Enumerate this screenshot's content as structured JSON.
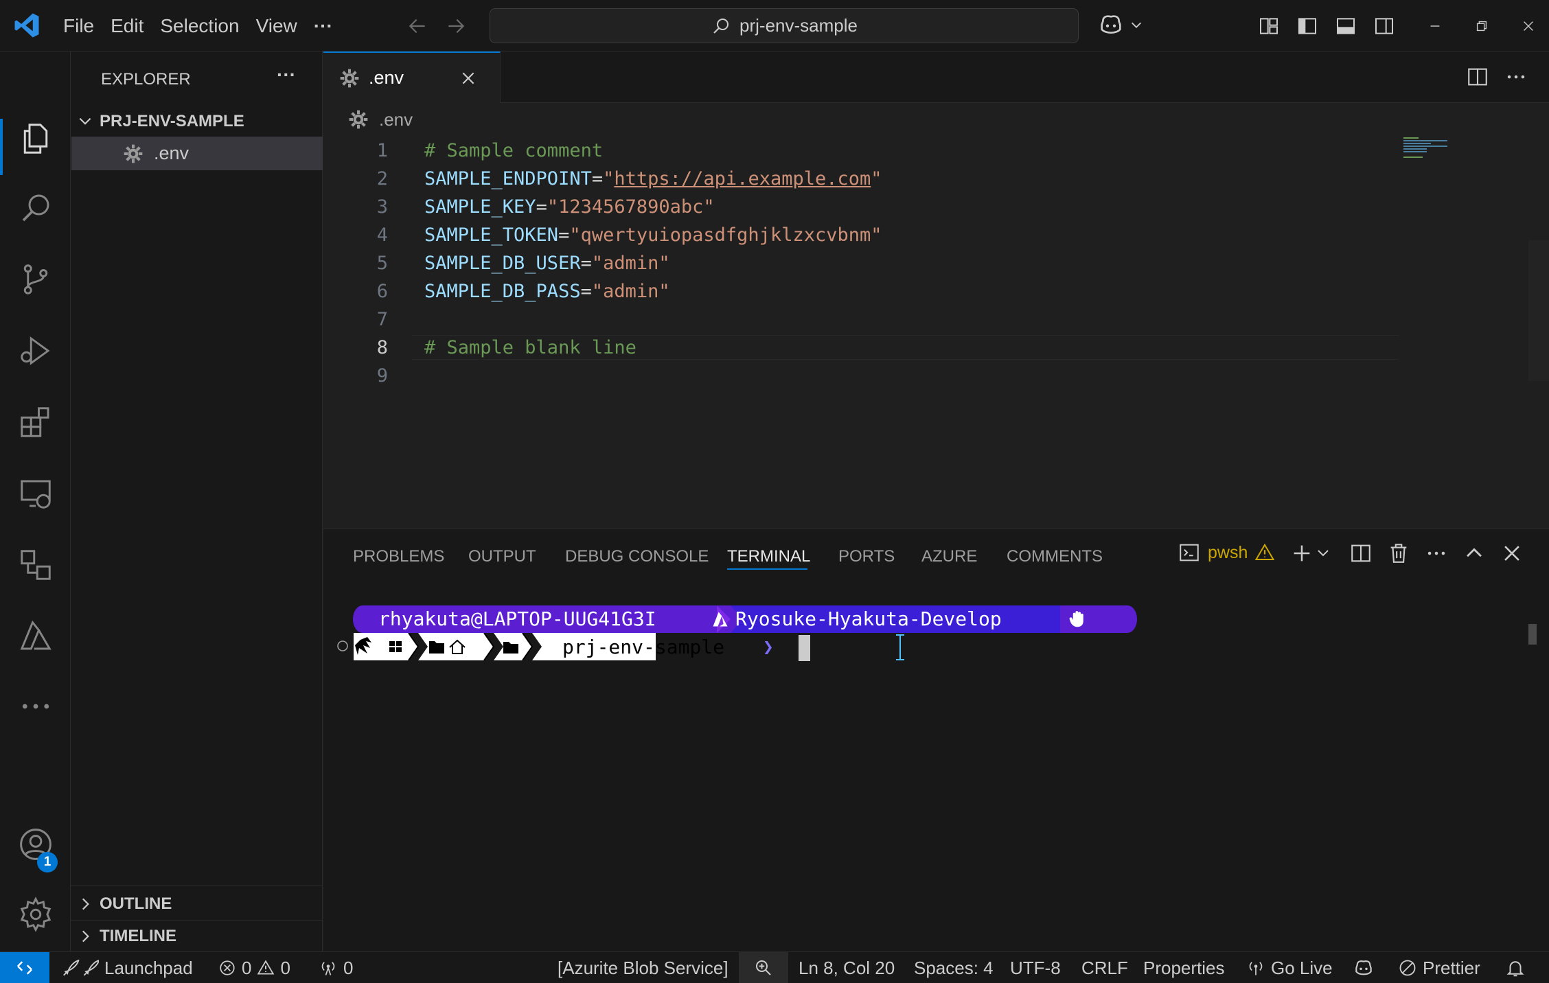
{
  "titlebar": {
    "menu": [
      "File",
      "Edit",
      "Selection",
      "View"
    ],
    "more": "···",
    "search_text": "prj-env-sample"
  },
  "sidebar": {
    "title": "EXPLORER",
    "more": "···",
    "folder": "PRJ-ENV-SAMPLE",
    "file": ".env",
    "outline": "OUTLINE",
    "timeline": "TIMELINE"
  },
  "editor": {
    "tab_label": ".env",
    "breadcrumb": ".env",
    "current_line": 8,
    "lines": [
      {
        "n": "1",
        "parts": [
          {
            "t": "# Sample comment",
            "c": "comment"
          }
        ]
      },
      {
        "n": "2",
        "parts": [
          {
            "t": "SAMPLE_ENDPOINT",
            "c": "key"
          },
          {
            "t": "=",
            "c": "op"
          },
          {
            "t": "\"",
            "c": "str"
          },
          {
            "t": "https://api.example.com",
            "c": "url"
          },
          {
            "t": "\"",
            "c": "str"
          }
        ]
      },
      {
        "n": "3",
        "parts": [
          {
            "t": "SAMPLE_KEY",
            "c": "key"
          },
          {
            "t": "=",
            "c": "op"
          },
          {
            "t": "\"1234567890abc\"",
            "c": "str"
          }
        ]
      },
      {
        "n": "4",
        "parts": [
          {
            "t": "SAMPLE_TOKEN",
            "c": "key"
          },
          {
            "t": "=",
            "c": "op"
          },
          {
            "t": "\"qwertyuiopasdfghjklzxcvbnm\"",
            "c": "str"
          }
        ]
      },
      {
        "n": "5",
        "parts": [
          {
            "t": "SAMPLE_DB_USER",
            "c": "key"
          },
          {
            "t": "=",
            "c": "op"
          },
          {
            "t": "\"admin\"",
            "c": "str"
          }
        ]
      },
      {
        "n": "6",
        "parts": [
          {
            "t": "SAMPLE_DB_PASS",
            "c": "key"
          },
          {
            "t": "=",
            "c": "op"
          },
          {
            "t": "\"admin\"",
            "c": "str"
          }
        ]
      },
      {
        "n": "7",
        "parts": []
      },
      {
        "n": "8",
        "parts": [
          {
            "t": "# Sample blank line",
            "c": "comment"
          }
        ]
      },
      {
        "n": "9",
        "parts": []
      }
    ]
  },
  "panel": {
    "tabs": [
      "PROBLEMS",
      "OUTPUT",
      "DEBUG CONSOLE",
      "TERMINAL",
      "PORTS",
      "AZURE",
      "COMMENTS"
    ],
    "active_tab": "TERMINAL",
    "shell": "pwsh",
    "prompt": {
      "user_host": "rhyakuta@LAPTOP-UUG41G3I",
      "azure_account": "Ryosuke-Hyakuta-Develop",
      "cwd": "prj-env-sample",
      "chevron": "❯"
    }
  },
  "statusbar": {
    "launchpad": "Launchpad",
    "errors": "0",
    "warnings": "0",
    "ports": "0",
    "azurite": "[Azurite Blob Service]",
    "position": "Ln 8, Col 20",
    "spaces": "Spaces: 4",
    "encoding": "UTF-8",
    "eol": "CRLF",
    "language": "Properties",
    "golive": "Go Live",
    "prettier": "Prettier"
  },
  "badges": {
    "accounts": "1"
  },
  "colors": {
    "accent": "#0078d4",
    "comment": "#6a9955",
    "key": "#9cdcfe",
    "string": "#ce9178",
    "prompt_purple": "#5b1fd1",
    "warning": "#cca700"
  }
}
